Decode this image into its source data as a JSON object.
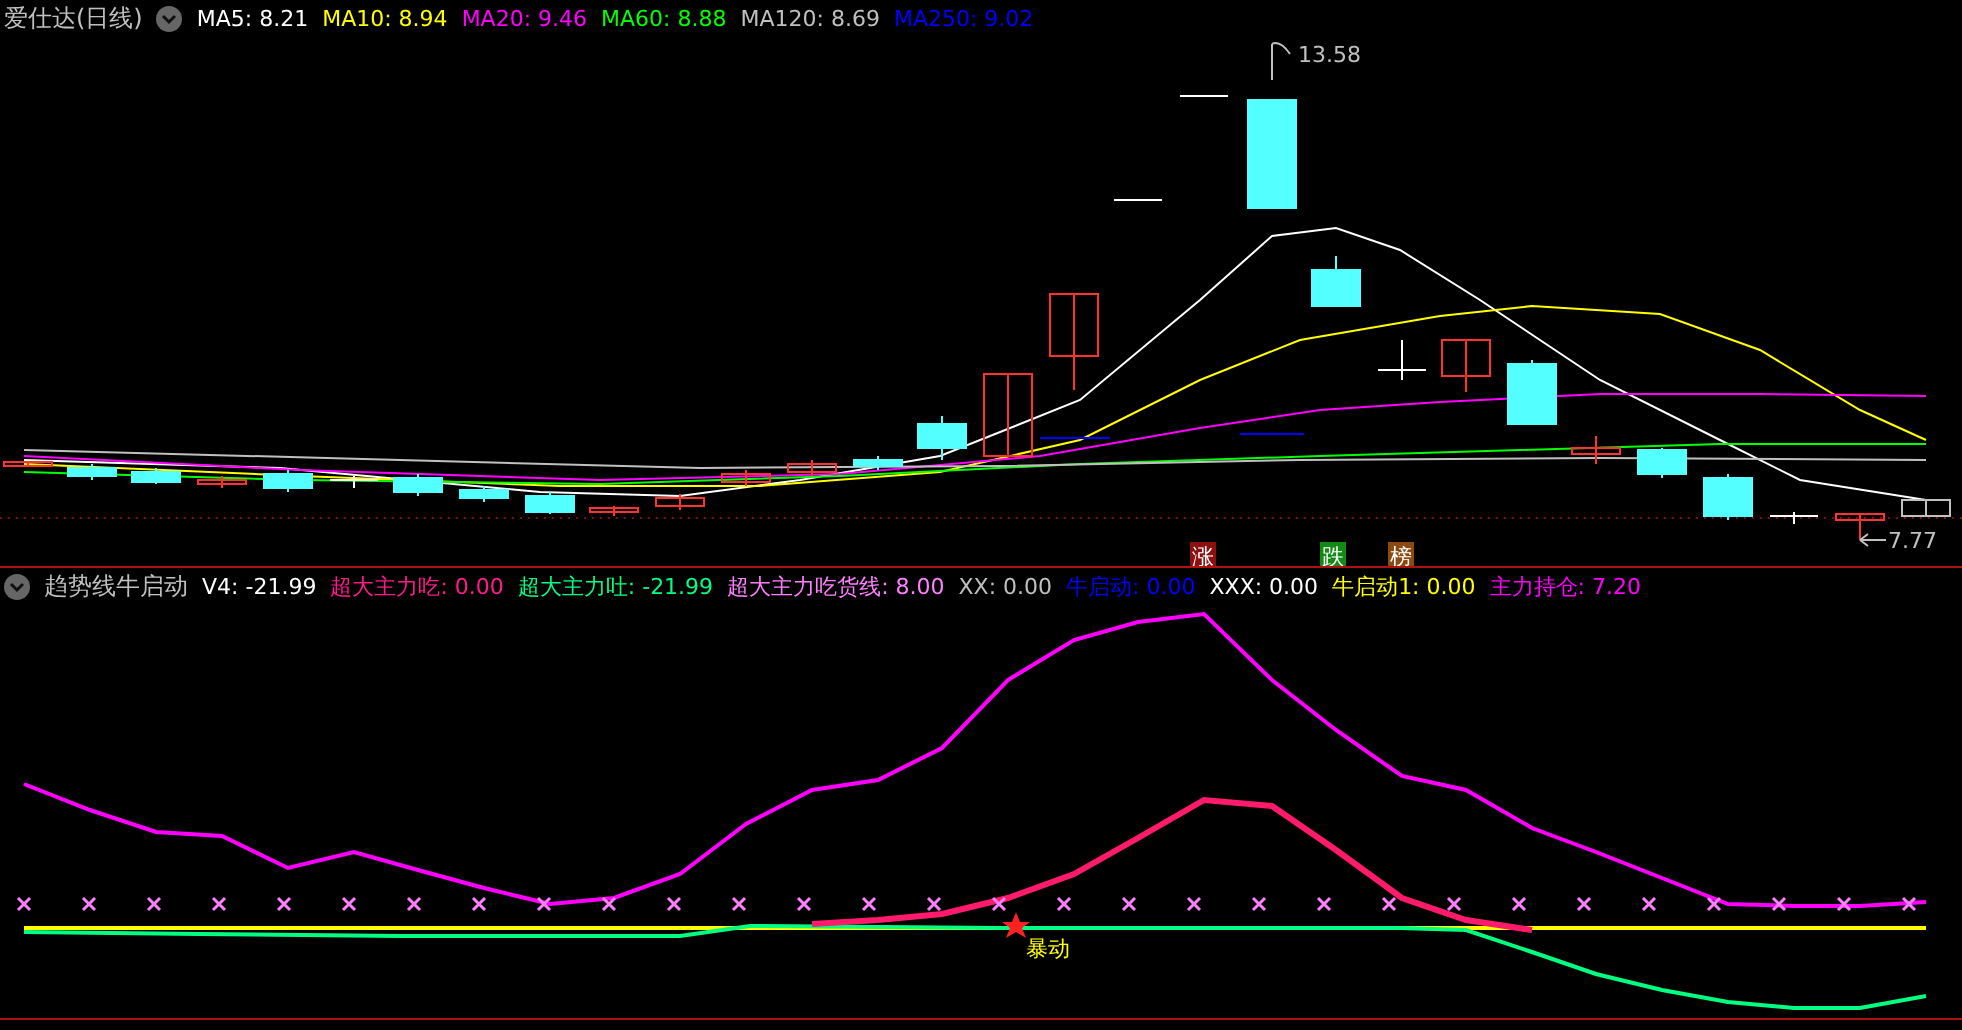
{
  "title": "爱仕达(日线)",
  "ma": [
    {
      "text": "MA5: 8.21",
      "color": "#ffffff"
    },
    {
      "text": "MA10: 8.94",
      "color": "#ffff00"
    },
    {
      "text": "MA20: 9.46",
      "color": "#ff00ff"
    },
    {
      "text": "MA60: 8.88",
      "color": "#00ff00"
    },
    {
      "text": "MA120: 8.69",
      "color": "#c0c0c0"
    },
    {
      "text": "MA250: 9.02",
      "color": "#0000ff"
    }
  ],
  "price_high": "13.58",
  "price_low": "7.77",
  "badges": [
    {
      "text": "涨",
      "color": "#8b1010"
    },
    {
      "text": "跌",
      "color": "#138a13"
    },
    {
      "text": "榜",
      "color": "#8b4a10"
    }
  ],
  "indicator": {
    "title": "趋势线牛启动",
    "items": [
      {
        "text": "V4: -21.99",
        "color": "#ffffff"
      },
      {
        "text": "超大主力吃: 0.00",
        "color": "#ff1a8c"
      },
      {
        "text": "超大主力吐: -21.99",
        "color": "#00ff80"
      },
      {
        "text": "超大主力吃货线: 8.00",
        "color": "#ff80ff"
      },
      {
        "text": "XX: 0.00",
        "color": "#c0c0c0"
      },
      {
        "text": "牛启动: 0.00",
        "color": "#0000ff"
      },
      {
        "text": "XXX: 0.00",
        "color": "#ffffff"
      },
      {
        "text": "牛启动1: 0.00",
        "color": "#ffff00"
      },
      {
        "text": "主力持仓: 7.20",
        "color": "#ff00ff"
      }
    ]
  },
  "signal_label": "暴动"
}
